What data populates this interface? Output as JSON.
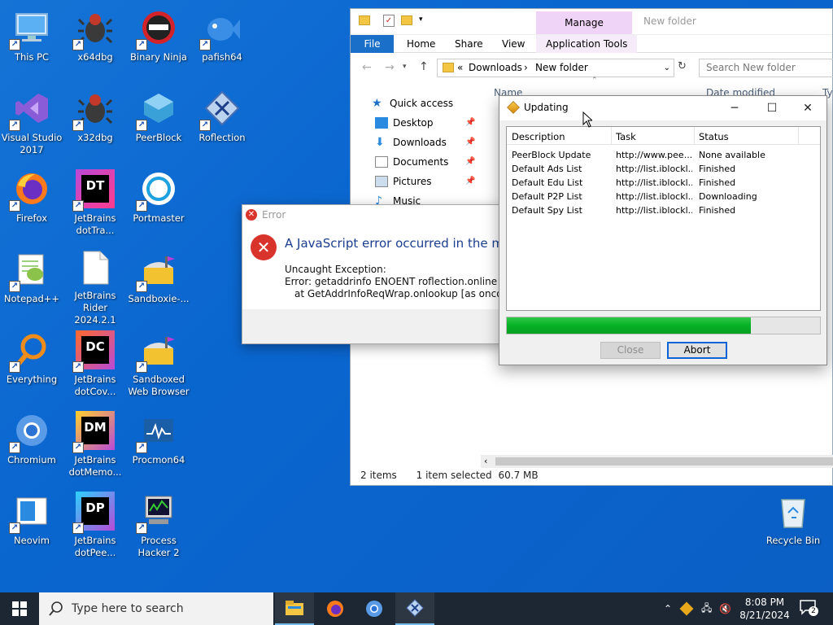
{
  "desktop": {
    "icons": [
      {
        "label": "This PC",
        "icon": "computer-icon"
      },
      {
        "label": "x64dbg",
        "icon": "bug-icon"
      },
      {
        "label": "Binary Ninja",
        "icon": "ninja-icon"
      },
      {
        "label": "pafish64",
        "icon": "fish-icon"
      },
      {
        "label": "Visual Studio\n2017",
        "icon": "visual-studio-icon"
      },
      {
        "label": "x32dbg",
        "icon": "bug-icon"
      },
      {
        "label": "PeerBlock",
        "icon": "shield-icon"
      },
      {
        "label": "Roflection",
        "icon": "roflection-icon"
      },
      {
        "label": "Firefox",
        "icon": "firefox-icon"
      },
      {
        "label": "JetBrains\ndotTra...",
        "icon": "jetbrains-dt-icon",
        "badge": "DT"
      },
      {
        "label": "Portmaster",
        "icon": "portmaster-icon"
      },
      {
        "label": "Notepad++",
        "icon": "notepadpp-icon"
      },
      {
        "label": "JetBrains\nRider 2024.2.1",
        "icon": "document-icon"
      },
      {
        "label": "Sandboxie-...",
        "icon": "sandboxie-icon"
      },
      {
        "label": "Everything",
        "icon": "search-icon"
      },
      {
        "label": "JetBrains\ndotCov...",
        "icon": "jetbrains-dc-icon",
        "badge": "DC"
      },
      {
        "label": "Sandboxed\nWeb Browser",
        "icon": "sandboxie-icon"
      },
      {
        "label": "Chromium",
        "icon": "chromium-icon"
      },
      {
        "label": "JetBrains\ndotMemo...",
        "icon": "jetbrains-dm-icon",
        "badge": "DM"
      },
      {
        "label": "Procmon64",
        "icon": "procmon-icon"
      },
      {
        "label": "Neovim",
        "icon": "neovim-icon"
      },
      {
        "label": "JetBrains\ndotPee...",
        "icon": "jetbrains-dp-icon",
        "badge": "DP"
      },
      {
        "label": "Process\nHacker 2",
        "icon": "process-hacker-icon"
      },
      {
        "label": "Recycle Bin",
        "icon": "recycle-bin-icon"
      }
    ]
  },
  "explorer": {
    "ribbon_context": "Manage",
    "window_title": "New folder",
    "tabs": [
      "File",
      "Home",
      "Share",
      "View",
      "Application Tools"
    ],
    "breadcrumb": {
      "prefix": "«",
      "items": [
        "Downloads",
        "New folder"
      ]
    },
    "search_placeholder": "Search New folder",
    "columns": {
      "name": "Name",
      "date": "Date modified",
      "type": "Ty"
    },
    "nav": [
      {
        "label": "Quick access",
        "icon": "star-icon",
        "pinned": false
      },
      {
        "label": "Desktop",
        "icon": "desktop-folder-icon",
        "pinned": true
      },
      {
        "label": "Downloads",
        "icon": "download-icon",
        "pinned": true
      },
      {
        "label": "Documents",
        "icon": "documents-icon",
        "pinned": true
      },
      {
        "label": "Pictures",
        "icon": "pictures-icon",
        "pinned": true
      },
      {
        "label": "Music",
        "icon": "music-icon",
        "pinned": false
      }
    ],
    "status": {
      "items": "2 items",
      "selected": "1 item selected",
      "size": "60.7 MB"
    }
  },
  "error_dialog": {
    "title": "Error",
    "heading": "A JavaScript error occurred in the main",
    "line1": "Uncaught Exception:",
    "line2": "Error: getaddrinfo ENOENT roflection.online",
    "line3": "at GetAddrInfoReqWrap.onlookup [as oncomple"
  },
  "updating": {
    "title": "Updating",
    "columns": {
      "description": "Description",
      "task": "Task",
      "status": "Status"
    },
    "rows": [
      {
        "description": "PeerBlock Update",
        "task": "http://www.pee...",
        "status": "None available"
      },
      {
        "description": "Default Ads List",
        "task": "http://list.iblockl...",
        "status": "Finished"
      },
      {
        "description": "Default Edu List",
        "task": "http://list.iblockl...",
        "status": "Finished"
      },
      {
        "description": "Default P2P List",
        "task": "http://list.iblockl...",
        "status": "Downloading"
      },
      {
        "description": "Default Spy List",
        "task": "http://list.iblockl...",
        "status": "Finished"
      }
    ],
    "progress_percent": 78,
    "close_label": "Close",
    "abort_label": "Abort"
  },
  "taskbar": {
    "search_placeholder": "Type here to search",
    "time": "8:08 PM",
    "date": "8/21/2024",
    "notification_count": "2",
    "apps": [
      "file-explorer-icon",
      "firefox-icon",
      "chromium-icon",
      "roflection-icon"
    ]
  },
  "colors": {
    "desktop": "#0b66cf",
    "accent": "#1a6fc9",
    "taskbar": "#1c2733",
    "progress": "#06b025",
    "error": "#d9342b"
  }
}
